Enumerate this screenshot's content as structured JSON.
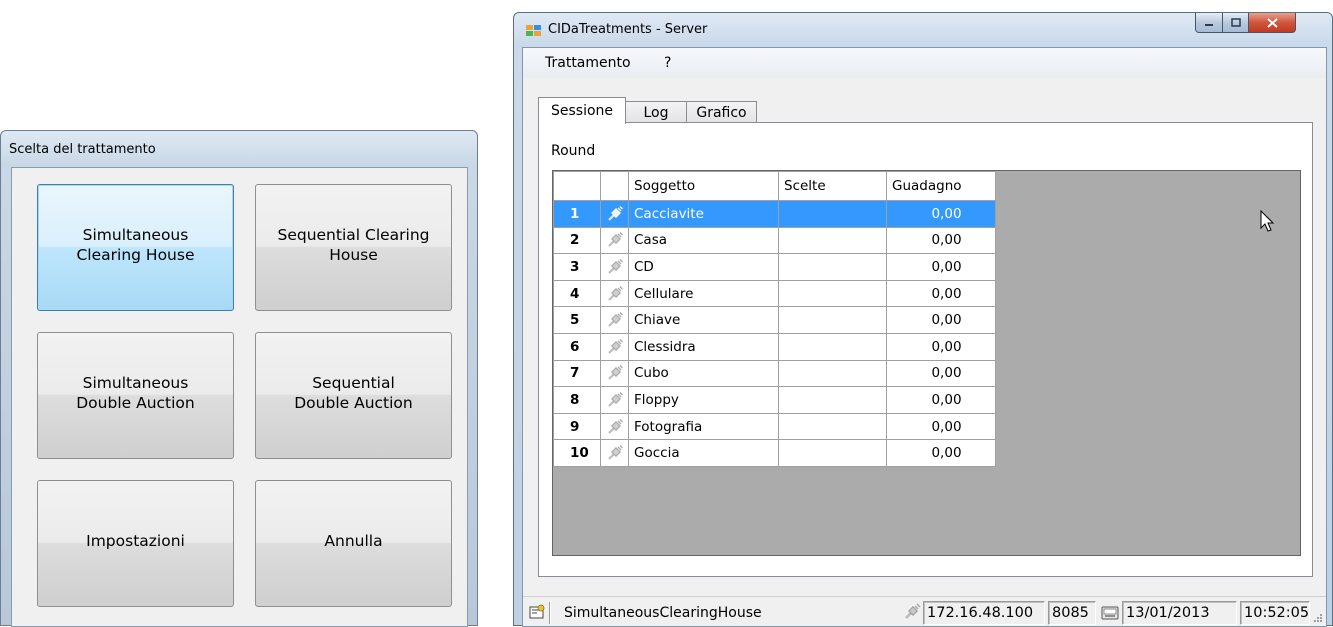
{
  "dialog": {
    "title": "Scelta del trattamento",
    "buttons": [
      {
        "label": "Simultaneous\nClearing House"
      },
      {
        "label": "Sequential Clearing\nHouse"
      },
      {
        "label": "Simultaneous\nDouble Auction"
      },
      {
        "label": "Sequential\nDouble Auction"
      },
      {
        "label": "Impostazioni"
      },
      {
        "label": "Annulla"
      }
    ]
  },
  "window": {
    "title": "CIDaTreatments - Server",
    "menu": [
      "Trattamento",
      "?"
    ],
    "tabs": [
      "Sessione",
      "Log",
      "Grafico"
    ],
    "active_tab": "Sessione",
    "round_label": "Round",
    "table": {
      "columns": [
        "Soggetto",
        "Scelte",
        "Guadagno"
      ],
      "rows": [
        {
          "n": "1",
          "soggetto": "Cacciavite",
          "scelte": "",
          "guadagno": "0,00",
          "selected": true
        },
        {
          "n": "2",
          "soggetto": "Casa",
          "scelte": "",
          "guadagno": "0,00"
        },
        {
          "n": "3",
          "soggetto": "CD",
          "scelte": "",
          "guadagno": "0,00"
        },
        {
          "n": "4",
          "soggetto": "Cellulare",
          "scelte": "",
          "guadagno": "0,00"
        },
        {
          "n": "5",
          "soggetto": "Chiave",
          "scelte": "",
          "guadagno": "0,00"
        },
        {
          "n": "6",
          "soggetto": "Clessidra",
          "scelte": "",
          "guadagno": "0,00"
        },
        {
          "n": "7",
          "soggetto": "Cubo",
          "scelte": "",
          "guadagno": "0,00"
        },
        {
          "n": "8",
          "soggetto": "Floppy",
          "scelte": "",
          "guadagno": "0,00"
        },
        {
          "n": "9",
          "soggetto": "Fotografia",
          "scelte": "",
          "guadagno": "0,00"
        },
        {
          "n": "10",
          "soggetto": "Goccia",
          "scelte": "",
          "guadagno": "0,00"
        }
      ]
    },
    "status": {
      "treatment": "SimultaneousClearingHouse",
      "ip": "172.16.48.100",
      "port": "8085",
      "date": "13/01/2013",
      "time": "10:52:05"
    }
  },
  "colors": {
    "selection": "#3399ff",
    "grid_background": "#ababab",
    "focus_border": "#3c7fb1"
  }
}
